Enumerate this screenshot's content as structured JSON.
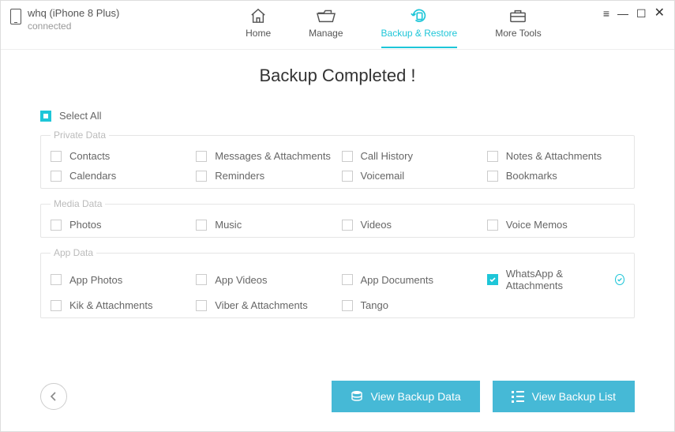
{
  "device": {
    "name": "whq (iPhone 8 Plus)",
    "status": "connected"
  },
  "nav": {
    "home": "Home",
    "manage": "Manage",
    "backup_restore": "Backup & Restore",
    "more_tools": "More Tools"
  },
  "title": "Backup Completed !",
  "select_all": "Select All",
  "sections": {
    "private": {
      "legend": "Private Data",
      "items": {
        "contacts": "Contacts",
        "messages": "Messages & Attachments",
        "call_history": "Call History",
        "notes": "Notes & Attachments",
        "calendars": "Calendars",
        "reminders": "Reminders",
        "voicemail": "Voicemail",
        "bookmarks": "Bookmarks"
      }
    },
    "media": {
      "legend": "Media Data",
      "items": {
        "photos": "Photos",
        "music": "Music",
        "videos": "Videos",
        "voice_memos": "Voice Memos"
      }
    },
    "app": {
      "legend": "App Data",
      "items": {
        "app_photos": "App Photos",
        "app_videos": "App Videos",
        "app_documents": "App Documents",
        "whatsapp": "WhatsApp & Attachments",
        "kik": "Kik & Attachments",
        "viber": "Viber & Attachments",
        "tango": "Tango"
      }
    }
  },
  "buttons": {
    "view_data": "View Backup Data",
    "view_list": "View Backup List"
  },
  "colors": {
    "accent": "#1ec6d8"
  }
}
